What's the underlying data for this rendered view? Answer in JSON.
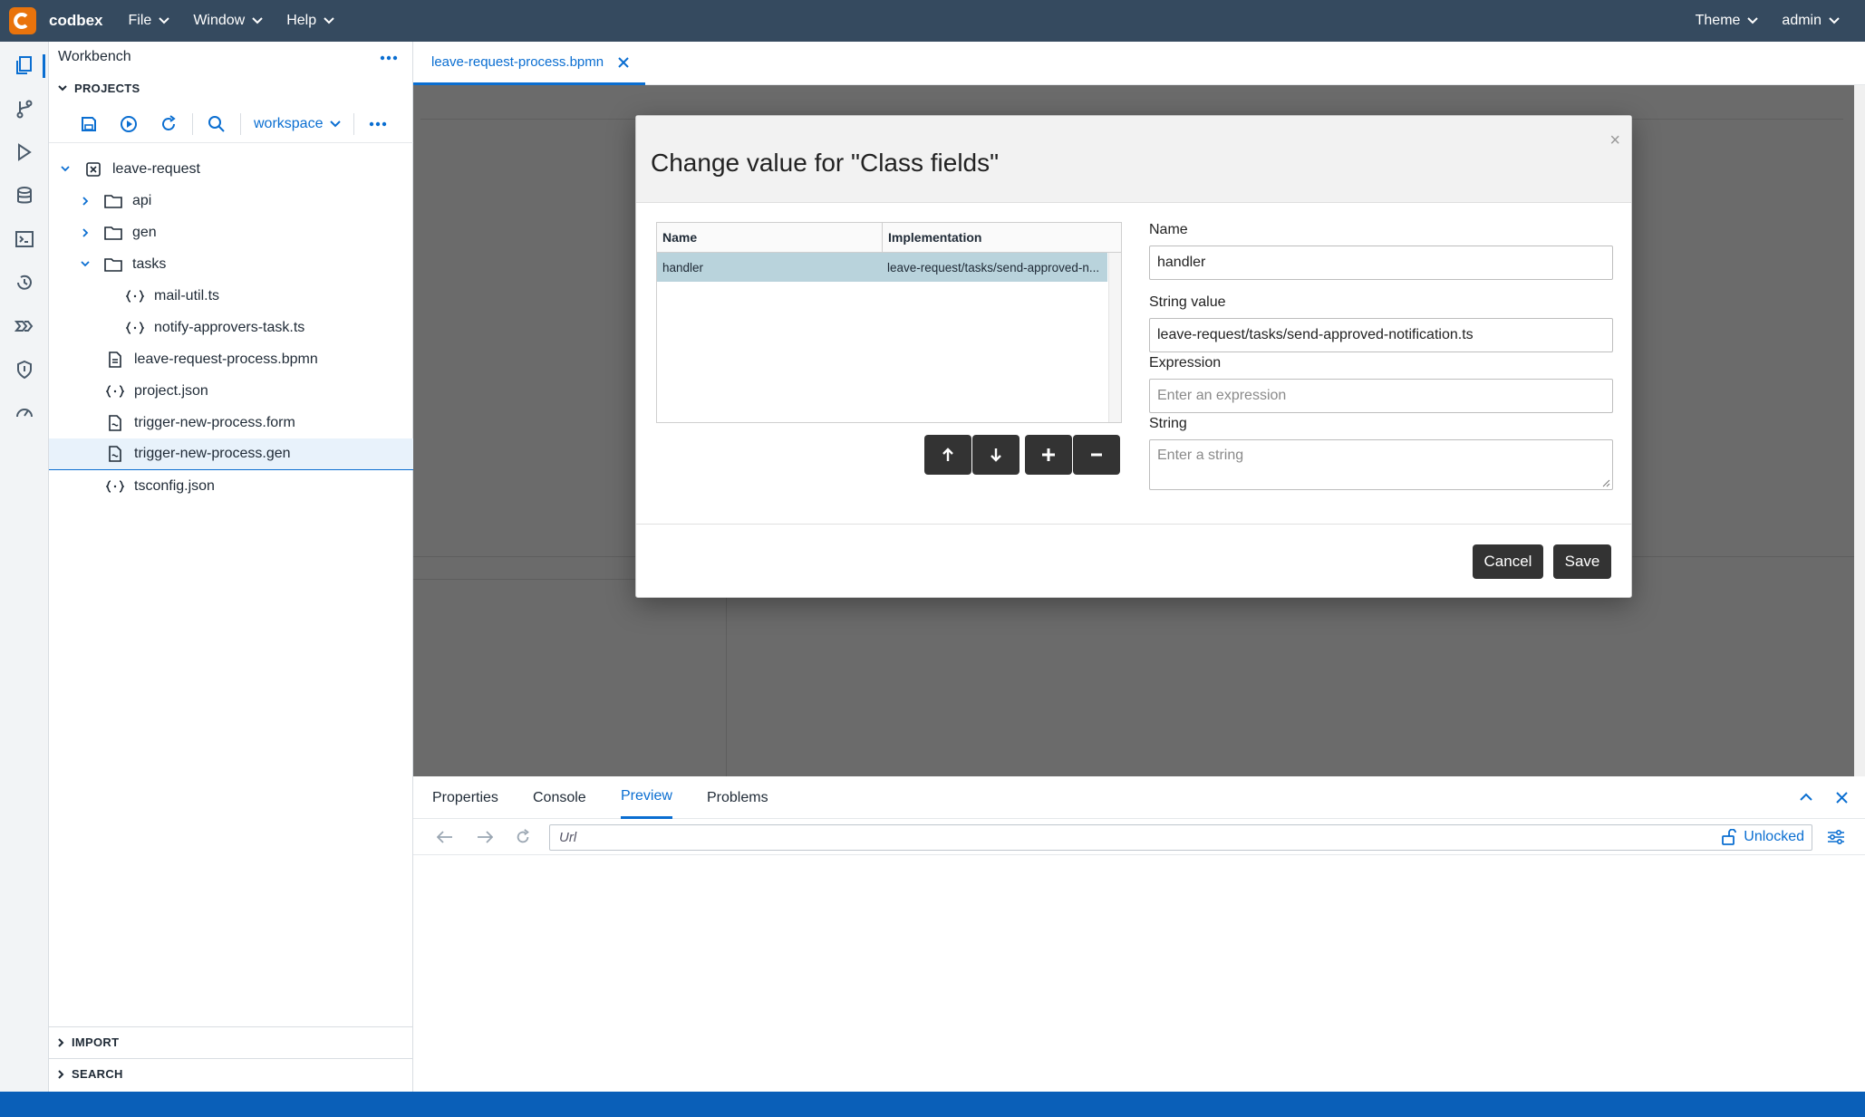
{
  "app": {
    "name": "codbex"
  },
  "menu": {
    "file": "File",
    "window": "Window",
    "help": "Help",
    "theme": "Theme",
    "user": "admin"
  },
  "explorer": {
    "title": "Workbench",
    "projects_header": "PROJECTS",
    "workspace": "workspace",
    "tree": [
      {
        "label": "leave-request"
      },
      {
        "label": "api"
      },
      {
        "label": "gen"
      },
      {
        "label": "tasks"
      },
      {
        "label": "mail-util.ts"
      },
      {
        "label": "notify-approvers-task.ts"
      },
      {
        "label": "leave-request-process.bpmn"
      },
      {
        "label": "project.json"
      },
      {
        "label": "trigger-new-process.form"
      },
      {
        "label": "trigger-new-process.gen"
      },
      {
        "label": "tsconfig.json"
      }
    ],
    "import_header": "IMPORT",
    "search_header": "SEARCH"
  },
  "editor": {
    "tab": "leave-request-process.bpmn"
  },
  "modal": {
    "title": "Change value for \"Class fields\"",
    "close": "×",
    "grid": {
      "headers": [
        "Name",
        "Implementation"
      ],
      "rows": [
        {
          "name": "handler",
          "implementation": "leave-request/tasks/send-approved-n..."
        }
      ]
    },
    "form": {
      "name_label": "Name",
      "name_value": "handler",
      "string_value_label": "String value",
      "string_value": "leave-request/tasks/send-approved-notification.ts",
      "expression_label": "Expression",
      "expression_placeholder": "Enter an expression",
      "string_label": "String",
      "string_placeholder": "Enter a string"
    },
    "cancel": "Cancel",
    "save": "Save"
  },
  "panel": {
    "tabs": [
      "Properties",
      "Console",
      "Preview",
      "Problems"
    ],
    "url_placeholder": "Url",
    "lock_status": "Unlocked"
  },
  "colors": {
    "topbar": "#354a5f",
    "accent": "#0a6ed1",
    "logo": "#e9730c",
    "statusbar": "#0a5fb8"
  }
}
